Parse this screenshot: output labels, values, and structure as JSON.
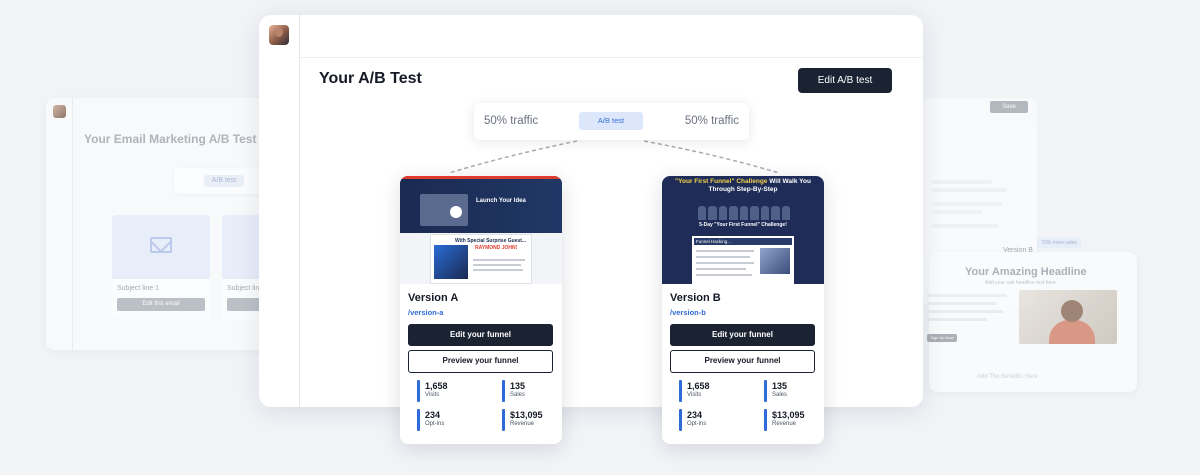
{
  "background_left": {
    "title": "Your Email Marketing A/B Test",
    "tag": "A/B test",
    "cards": [
      {
        "subject": "Subject line 1",
        "button": "Edit this email"
      },
      {
        "subject": "Subject lin",
        "button": ""
      }
    ]
  },
  "background_right": {
    "save": "Save",
    "variant_label": "Version B",
    "badge": "70% more sales",
    "headline": "Your Amazing Headline",
    "subheadline": "Add your sub headline text here",
    "cta": "Sign Up Now",
    "bottom": "Add The Benefits Here"
  },
  "main": {
    "title": "Your A/B Test",
    "edit_button": "Edit A/B test",
    "traffic": {
      "left": "50% traffic",
      "tag": "A/B test",
      "right": "50% traffic"
    }
  },
  "versions": [
    {
      "name": "Version A",
      "path": "/version-a",
      "edit_label": "Edit your funnel",
      "preview_label": "Preview your funnel",
      "thumb": {
        "headline": "Launch Your Idea",
        "book_title": "With Special Surprise Guest...",
        "book_name": "RAYMOND JOHN!"
      },
      "stats": [
        {
          "value": "1,658",
          "label": "Visits"
        },
        {
          "value": "135",
          "label": "Sales"
        },
        {
          "value": "234",
          "label": "Opt-ins"
        },
        {
          "value": "$13,095",
          "label": "Revenue"
        }
      ]
    },
    {
      "name": "Version B",
      "path": "/version-b",
      "edit_label": "Edit your funnel",
      "preview_label": "Preview your funnel",
      "thumb": {
        "headline_yellow": "\"Your First Funnel\" Challenge",
        "headline_rest": " Will Walk You Through Step-By-Step",
        "sub": "5-Day \"Your First Funnel\" Challenge!",
        "panel_title": "Funnel Hacking..."
      },
      "stats": [
        {
          "value": "1,658",
          "label": "Visits"
        },
        {
          "value": "135",
          "label": "Sales"
        },
        {
          "value": "234",
          "label": "Opt-ins"
        },
        {
          "value": "$13,095",
          "label": "Revenue"
        }
      ]
    }
  ],
  "colors": {
    "dark_button": "#1b2333",
    "accent_blue": "#2f6bd6",
    "tag_bg": "#dce7fb",
    "background": "#f1f3f7"
  }
}
